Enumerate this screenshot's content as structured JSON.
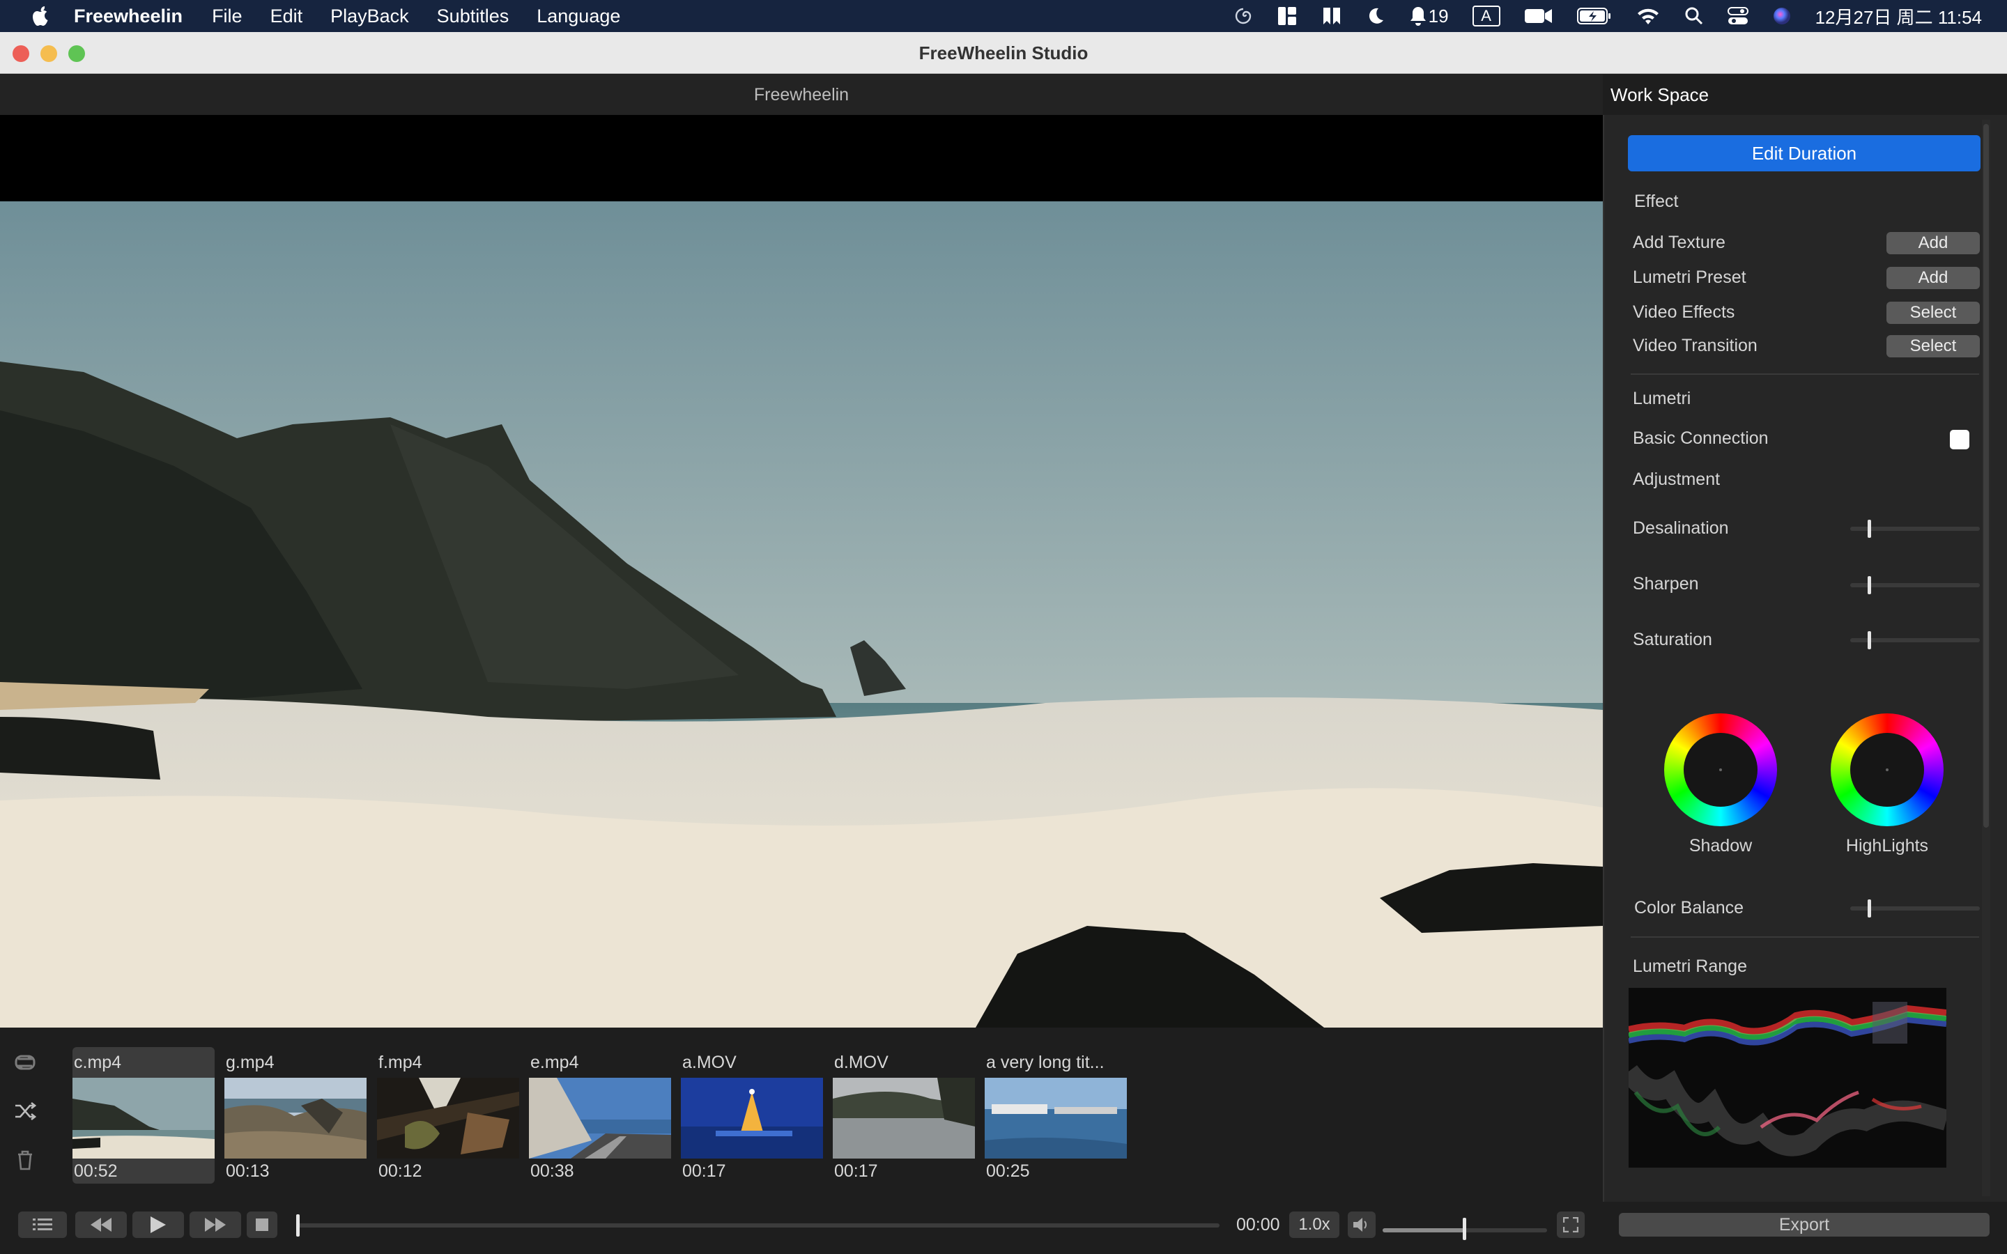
{
  "menubar": {
    "app_name": "Freewheelin",
    "items": [
      "File",
      "Edit",
      "PlayBack",
      "Subtitles",
      "Language"
    ],
    "notification_count": "19",
    "input_method": "A",
    "clock": "12月27日 周二  11:54"
  },
  "window": {
    "title": "FreeWheelin Studio"
  },
  "viewer": {
    "header": "Freewheelin"
  },
  "workspace": {
    "header": "Work Space",
    "edit_duration_label": "Edit Duration",
    "effect_section": "Effect",
    "effect_rows": [
      {
        "label": "Add Texture",
        "button": "Add"
      },
      {
        "label": "Lumetri Preset",
        "button": "Add"
      },
      {
        "label": "Video Effects",
        "button": "Select"
      },
      {
        "label": "Video Transition",
        "button": "Select"
      }
    ],
    "lumetri_section": "Lumetri",
    "basic_connection_label": "Basic Connection",
    "basic_connection_checked": false,
    "adjustment_section": "Adjustment",
    "sliders": [
      {
        "label": "Desalination",
        "value": 0
      },
      {
        "label": "Sharpen",
        "value": 0
      },
      {
        "label": "Saturation",
        "value": 0
      }
    ],
    "wheels": [
      {
        "label": "Shadow"
      },
      {
        "label": "HighLights"
      }
    ],
    "color_balance_label": "Color Balance",
    "color_balance_value": 0,
    "lumetri_range_label": "Lumetri Range",
    "export_label": "Export"
  },
  "playlist": {
    "clips": [
      {
        "title": "c.mp4",
        "duration": "00:52",
        "selected": true
      },
      {
        "title": "g.mp4",
        "duration": "00:13",
        "selected": false
      },
      {
        "title": "f.mp4",
        "duration": "00:12",
        "selected": false
      },
      {
        "title": "e.mp4",
        "duration": "00:38",
        "selected": false
      },
      {
        "title": "a.MOV",
        "duration": "00:17",
        "selected": false
      },
      {
        "title": "d.MOV",
        "duration": "00:17",
        "selected": false
      },
      {
        "title": "a very long tit...",
        "duration": "00:25",
        "selected": false
      }
    ]
  },
  "transport": {
    "time": "00:00",
    "speed": "1.0x",
    "progress": 0.0,
    "volume": 0.5
  },
  "colors": {
    "accent": "#1a6de0",
    "menubar_bg": "#16243f",
    "panel_bg": "#262626",
    "app_bg": "#1e1e1e"
  }
}
